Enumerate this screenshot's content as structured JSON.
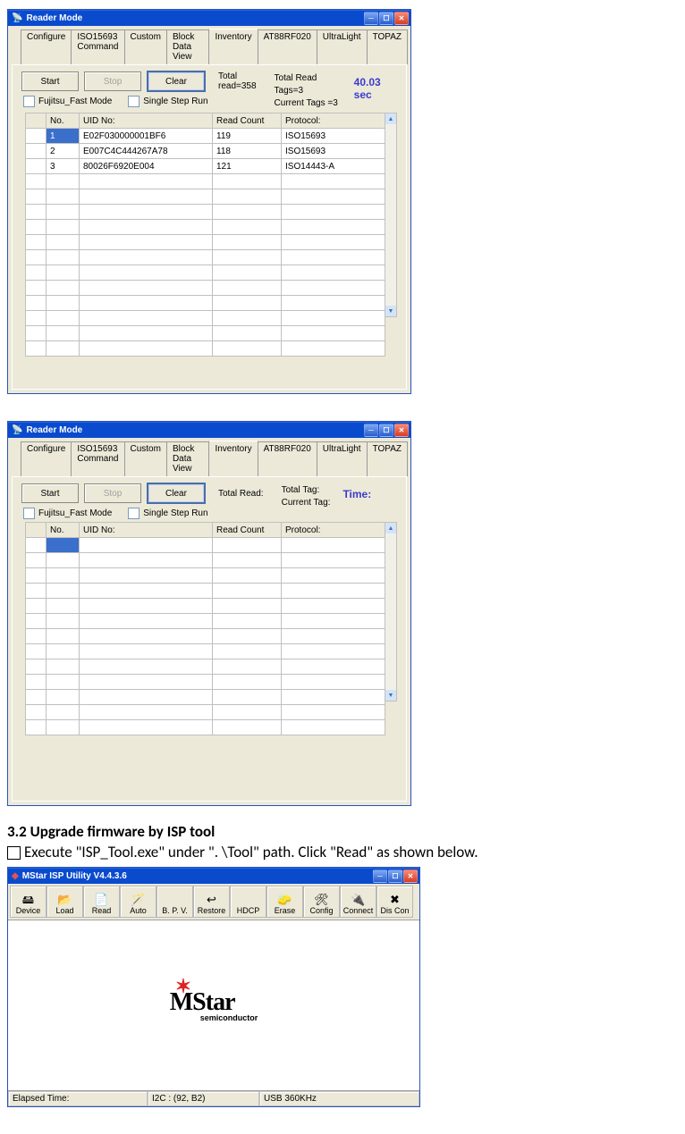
{
  "reader1": {
    "title": "Reader Mode",
    "tabs": [
      "Configure",
      "ISO15693 Command",
      "Custom",
      "Block Data View",
      "Inventory",
      "AT88RF020",
      "UltraLight",
      "TOPAZ"
    ],
    "active_tab": 4,
    "buttons": {
      "start": "Start",
      "stop": "Stop",
      "clear": "Clear"
    },
    "checks": {
      "fujitsu": "Fujitsu_Fast Mode",
      "singlestep": "Single Step Run"
    },
    "labels": {
      "total_read": "Total read=358",
      "total_tags": "Total Read Tags=3",
      "current_tags": "Current Tags =3"
    },
    "time": "40.03 sec",
    "headers": [
      "No.",
      "UID No:",
      "Read Count",
      "Protocol:"
    ],
    "rows": [
      {
        "no": "1",
        "uid": "E02F030000001BF6",
        "count": "119",
        "proto": "ISO15693"
      },
      {
        "no": "2",
        "uid": "E007C4C444267A78",
        "count": "118",
        "proto": "ISO15693"
      },
      {
        "no": "3",
        "uid": "80026F6920E004",
        "count": "121",
        "proto": "ISO14443-A"
      }
    ]
  },
  "reader2": {
    "title": "Reader Mode",
    "labels": {
      "total_read": "Total Read:",
      "total_tag": "Total Tag:",
      "current_tag": "Current Tag:"
    },
    "time": "Time:"
  },
  "doc": {
    "heading": "3.2 Upgrade firmware by ISP tool",
    "body": "Execute \"ISP_Tool.exe\" under \". \\Tool\" path. Click \"Read\" as shown below."
  },
  "isp": {
    "title": "MStar ISP Utility V4.4.3.6",
    "buttons": [
      {
        "name": "device",
        "label": "Device",
        "glyph": "🖴"
      },
      {
        "name": "load",
        "label": "Load",
        "glyph": "📂"
      },
      {
        "name": "read",
        "label": "Read",
        "glyph": "📄"
      },
      {
        "name": "auto",
        "label": "Auto",
        "glyph": "🪄"
      },
      {
        "name": "bpv",
        "label": "B. P. V.",
        "glyph": ""
      },
      {
        "name": "restore",
        "label": "Restore",
        "glyph": "↩"
      },
      {
        "name": "hdcp",
        "label": "HDCP",
        "glyph": ""
      },
      {
        "name": "erase",
        "label": "Erase",
        "glyph": "🧽"
      },
      {
        "name": "config",
        "label": "Config",
        "glyph": "🛠"
      },
      {
        "name": "connect",
        "label": "Connect",
        "glyph": "🔌"
      },
      {
        "name": "discon",
        "label": "Dis Con",
        "glyph": "✖"
      }
    ],
    "logo": {
      "brand": "Star",
      "prefix": "M",
      "sub": "semiconductor"
    },
    "status": {
      "elapsed": "Elapsed Time:",
      "i2c": "I2C : (92, B2)",
      "usb": "USB  360KHz"
    }
  }
}
